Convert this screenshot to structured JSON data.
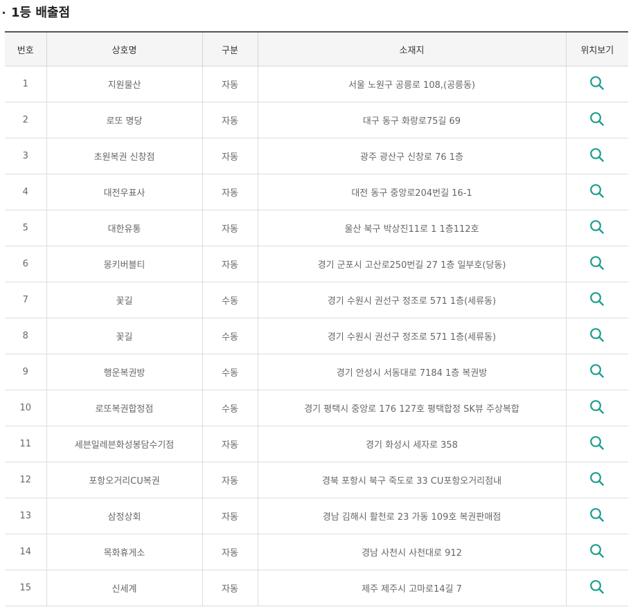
{
  "section": {
    "title": "1등 배출점"
  },
  "table": {
    "headers": [
      "번호",
      "상호명",
      "구분",
      "소재지",
      "위치보기"
    ],
    "rows": [
      {
        "no": "1",
        "name": "지원물산",
        "type": "자동",
        "address": "서울 노원구 공릉로 108,(공릉동)"
      },
      {
        "no": "2",
        "name": "로또 명당",
        "type": "자동",
        "address": "대구 동구 화랑로75길 69"
      },
      {
        "no": "3",
        "name": "초원복권 신창점",
        "type": "자동",
        "address": "광주 광산구 신창로 76 1층"
      },
      {
        "no": "4",
        "name": "대전우표사",
        "type": "자동",
        "address": "대전 동구 중앙로204번길 16-1"
      },
      {
        "no": "5",
        "name": "대한유통",
        "type": "자동",
        "address": "울산 북구 박상진11로 1 1층112호"
      },
      {
        "no": "6",
        "name": "몽키버블티",
        "type": "자동",
        "address": "경기 군포시 고산로250번길 27 1층 일부호(당동)"
      },
      {
        "no": "7",
        "name": "꽃길",
        "type": "수동",
        "address": "경기 수원시 권선구 정조로 571 1층(세류동)"
      },
      {
        "no": "8",
        "name": "꽃길",
        "type": "수동",
        "address": "경기 수원시 권선구 정조로 571 1층(세류동)"
      },
      {
        "no": "9",
        "name": "행운복권방",
        "type": "수동",
        "address": "경기 안성시 서동대로 7184 1층 복권방"
      },
      {
        "no": "10",
        "name": "로또복권합정점",
        "type": "수동",
        "address": "경기 평택시 중앙로 176 127호 평택합정 SK뷰 주상복합"
      },
      {
        "no": "11",
        "name": "세븐일레븐화성봉담수기점",
        "type": "자동",
        "address": "경기 화성시 세자로 358"
      },
      {
        "no": "12",
        "name": "포항오거리CU복권",
        "type": "자동",
        "address": "경북 포항시 북구 죽도로 33 CU포항오거리점내"
      },
      {
        "no": "13",
        "name": "삼정상회",
        "type": "자동",
        "address": "경남 김해시 활천로 23 가동 109호 복권판매점"
      },
      {
        "no": "14",
        "name": "목화휴게소",
        "type": "자동",
        "address": "경남 사천시 사천대로 912"
      },
      {
        "no": "15",
        "name": "신세계",
        "type": "자동",
        "address": "제주 제주시 고마로14길 7"
      }
    ]
  },
  "icons": {
    "location": "search-icon"
  },
  "colors": {
    "accent": "#1a9e8f"
  }
}
